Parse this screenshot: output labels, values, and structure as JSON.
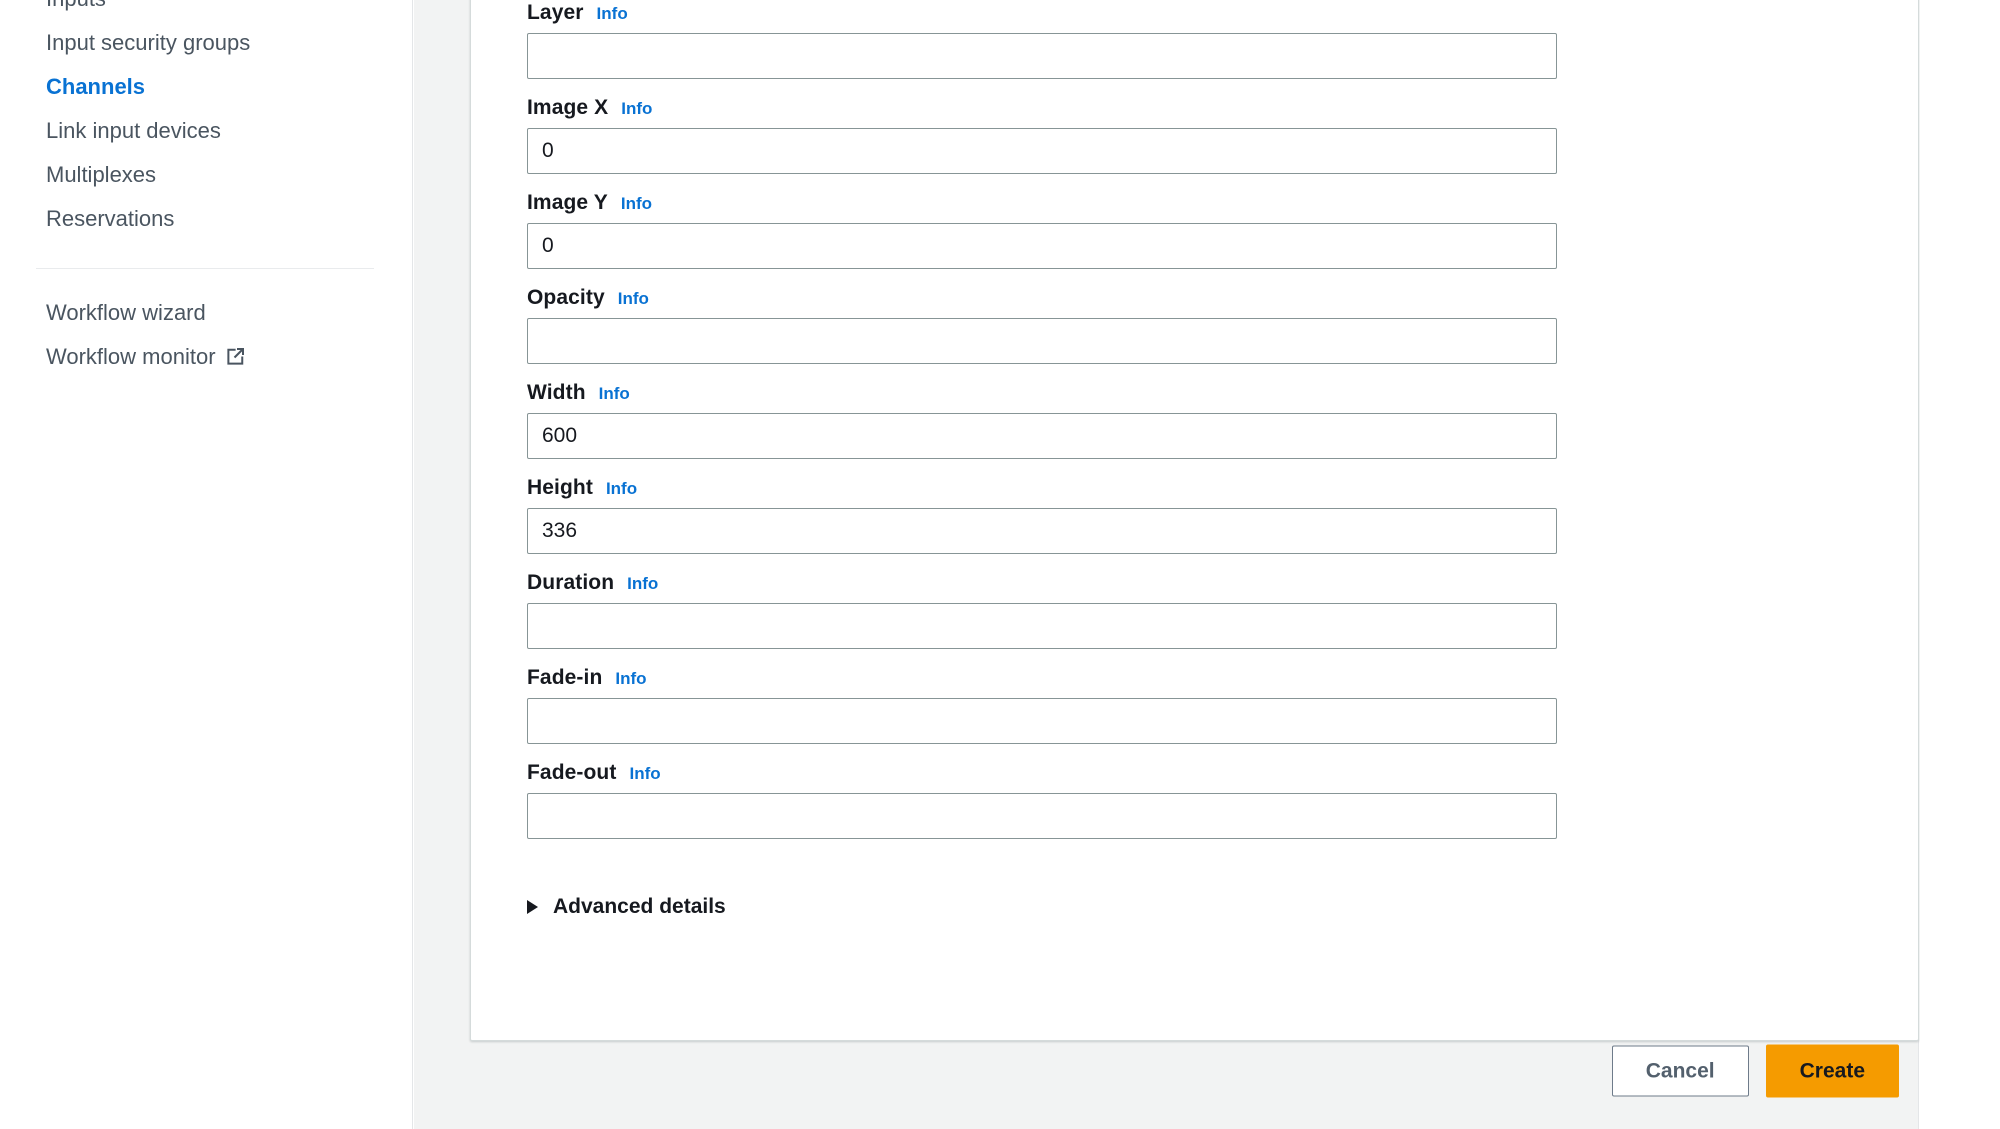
{
  "sidebar": {
    "items": [
      {
        "label": "Inputs",
        "active": false,
        "clipped": true,
        "external": false
      },
      {
        "label": "Input security groups",
        "active": false,
        "clipped": false,
        "external": false
      },
      {
        "label": "Channels",
        "active": true,
        "clipped": false,
        "external": false
      },
      {
        "label": "Link input devices",
        "active": false,
        "clipped": false,
        "external": false
      },
      {
        "label": "Multiplexes",
        "active": false,
        "clipped": false,
        "external": false
      },
      {
        "label": "Reservations",
        "active": false,
        "clipped": false,
        "external": false
      }
    ],
    "secondary_items": [
      {
        "label": "Workflow wizard",
        "external": false
      },
      {
        "label": "Workflow monitor",
        "external": true
      }
    ]
  },
  "form": {
    "info_label": "Info",
    "fields": [
      {
        "label": "Layer",
        "value": "",
        "placeholder": ""
      },
      {
        "label": "Image X",
        "value": "0",
        "placeholder": ""
      },
      {
        "label": "Image Y",
        "value": "0",
        "placeholder": ""
      },
      {
        "label": "Opacity",
        "value": "",
        "placeholder": ""
      },
      {
        "label": "Width",
        "value": "600",
        "placeholder": ""
      },
      {
        "label": "Height",
        "value": "336",
        "placeholder": ""
      },
      {
        "label": "Duration",
        "value": "",
        "placeholder": ""
      },
      {
        "label": "Fade-in",
        "value": "",
        "placeholder": ""
      },
      {
        "label": "Fade-out",
        "value": "",
        "placeholder": ""
      }
    ],
    "advanced_details_label": "Advanced details",
    "advanced_details_expanded": false
  },
  "footer": {
    "cancel_label": "Cancel",
    "create_label": "Create"
  },
  "colors": {
    "accent_link": "#0972d3",
    "primary_button": "#f59b00",
    "text": "#16191f",
    "sidebar_text": "#4a5560",
    "input_border": "#879596",
    "page_background": "#f2f3f3"
  }
}
